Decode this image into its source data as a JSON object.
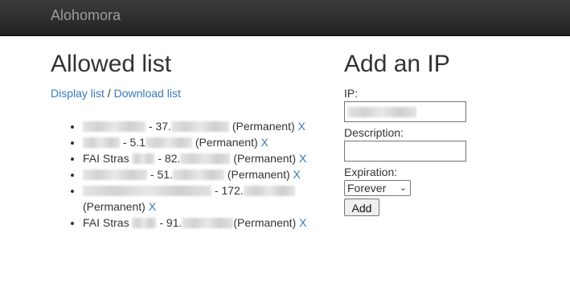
{
  "navbar": {
    "brand": "Alohomora"
  },
  "left": {
    "title": "Allowed list",
    "display_link": "Display list",
    "separator": " / ",
    "download_link": "Download list",
    "entries": [
      {
        "name": "",
        "ip_prefix": "37.",
        "status": "(Permanent)",
        "delete": "X"
      },
      {
        "name": "",
        "ip_prefix": "5.1",
        "status": "(Permanent)",
        "delete": "X"
      },
      {
        "name": "FAI Stras",
        "ip_prefix": "82.",
        "status": "(Permanent)",
        "delete": "X"
      },
      {
        "name": "",
        "ip_prefix": "51.",
        "status": "(Permanent)",
        "delete": "X"
      },
      {
        "name": "",
        "ip_prefix": "172.",
        "status": "(Permanent)",
        "delete": "X"
      },
      {
        "name": "FAI Stras",
        "ip_prefix": "91.",
        "status": "(Permanent)",
        "delete": "X"
      }
    ]
  },
  "right": {
    "title": "Add an IP",
    "ip_label": "IP:",
    "description_label": "Description:",
    "expiration_label": "Expiration:",
    "expiration_selected": "Forever",
    "add_button": "Add"
  }
}
